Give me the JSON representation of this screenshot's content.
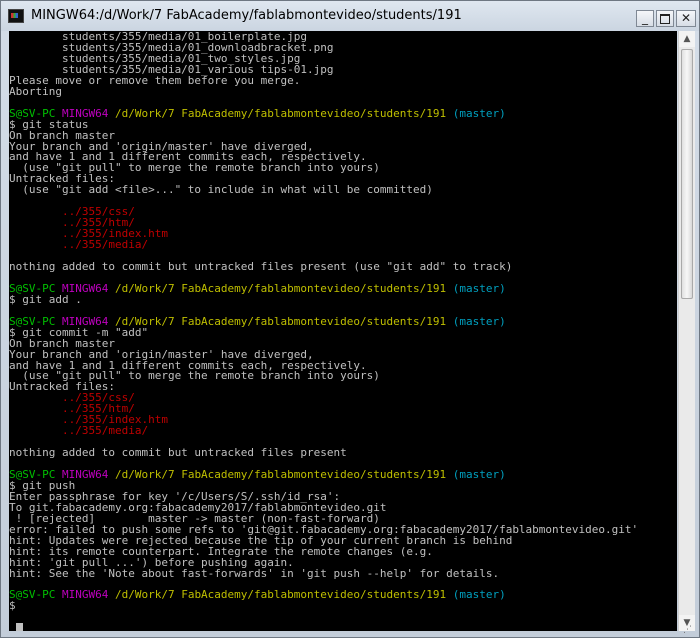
{
  "window": {
    "title": "MINGW64:/d/Work/7 FabAcademy/fablabmontevideo/students/191",
    "minimize": "_",
    "close": "✕"
  },
  "colors": {
    "green": "#00bf00",
    "magenta": "#bf00bf",
    "yellow": "#bfbf00",
    "cyan": "#00a0bf",
    "red": "#bf0000",
    "white": "#c0c0c0"
  },
  "terminal_lines": [
    [
      [
        "white",
        "        students/355/media/01_boilerplate.jpg"
      ]
    ],
    [
      [
        "white",
        "        students/355/media/01_downloadbracket.png"
      ]
    ],
    [
      [
        "white",
        "        students/355/media/01_two_styles.jpg"
      ]
    ],
    [
      [
        "white",
        "        students/355/media/01_various tips-01.jpg"
      ]
    ],
    [
      [
        "white",
        "Please move or remove them before you merge."
      ]
    ],
    [
      [
        "white",
        "Aborting"
      ]
    ],
    [
      [
        "white",
        ""
      ]
    ],
    [
      [
        "green",
        "S@SV-PC "
      ],
      [
        "magenta",
        "MINGW64 "
      ],
      [
        "yellow",
        "/d/Work/7 FabAcademy/fablabmontevideo/students/191"
      ],
      [
        "cyan",
        " (master)"
      ]
    ],
    [
      [
        "white",
        "$ git status"
      ]
    ],
    [
      [
        "white",
        "On branch master"
      ]
    ],
    [
      [
        "white",
        "Your branch and 'origin/master' have diverged,"
      ]
    ],
    [
      [
        "white",
        "and have 1 and 1 different commits each, respectively."
      ]
    ],
    [
      [
        "white",
        "  (use \"git pull\" to merge the remote branch into yours)"
      ]
    ],
    [
      [
        "white",
        "Untracked files:"
      ]
    ],
    [
      [
        "white",
        "  (use \"git add <file>...\" to include in what will be committed)"
      ]
    ],
    [
      [
        "white",
        ""
      ]
    ],
    [
      [
        "white",
        "        "
      ],
      [
        "red",
        "../355/css/"
      ]
    ],
    [
      [
        "white",
        "        "
      ],
      [
        "red",
        "../355/htm/"
      ]
    ],
    [
      [
        "white",
        "        "
      ],
      [
        "red",
        "../355/index.htm"
      ]
    ],
    [
      [
        "white",
        "        "
      ],
      [
        "red",
        "../355/media/"
      ]
    ],
    [
      [
        "white",
        ""
      ]
    ],
    [
      [
        "white",
        "nothing added to commit but untracked files present (use \"git add\" to track)"
      ]
    ],
    [
      [
        "white",
        ""
      ]
    ],
    [
      [
        "green",
        "S@SV-PC "
      ],
      [
        "magenta",
        "MINGW64 "
      ],
      [
        "yellow",
        "/d/Work/7 FabAcademy/fablabmontevideo/students/191"
      ],
      [
        "cyan",
        " (master)"
      ]
    ],
    [
      [
        "white",
        "$ git add ."
      ]
    ],
    [
      [
        "white",
        ""
      ]
    ],
    [
      [
        "green",
        "S@SV-PC "
      ],
      [
        "magenta",
        "MINGW64 "
      ],
      [
        "yellow",
        "/d/Work/7 FabAcademy/fablabmontevideo/students/191"
      ],
      [
        "cyan",
        " (master)"
      ]
    ],
    [
      [
        "white",
        "$ git commit -m \"add\""
      ]
    ],
    [
      [
        "white",
        "On branch master"
      ]
    ],
    [
      [
        "white",
        "Your branch and 'origin/master' have diverged,"
      ]
    ],
    [
      [
        "white",
        "and have 1 and 1 different commits each, respectively."
      ]
    ],
    [
      [
        "white",
        "  (use \"git pull\" to merge the remote branch into yours)"
      ]
    ],
    [
      [
        "white",
        "Untracked files:"
      ]
    ],
    [
      [
        "white",
        "        "
      ],
      [
        "red",
        "../355/css/"
      ]
    ],
    [
      [
        "white",
        "        "
      ],
      [
        "red",
        "../355/htm/"
      ]
    ],
    [
      [
        "white",
        "        "
      ],
      [
        "red",
        "../355/index.htm"
      ]
    ],
    [
      [
        "white",
        "        "
      ],
      [
        "red",
        "../355/media/"
      ]
    ],
    [
      [
        "white",
        ""
      ]
    ],
    [
      [
        "white",
        "nothing added to commit but untracked files present"
      ]
    ],
    [
      [
        "white",
        ""
      ]
    ],
    [
      [
        "green",
        "S@SV-PC "
      ],
      [
        "magenta",
        "MINGW64 "
      ],
      [
        "yellow",
        "/d/Work/7 FabAcademy/fablabmontevideo/students/191"
      ],
      [
        "cyan",
        " (master)"
      ]
    ],
    [
      [
        "white",
        "$ git push"
      ]
    ],
    [
      [
        "white",
        "Enter passphrase for key '/c/Users/S/.ssh/id_rsa':"
      ]
    ],
    [
      [
        "white",
        "To git.fabacademy.org:fabacademy2017/fablabmontevideo.git"
      ]
    ],
    [
      [
        "white",
        " ! [rejected]        master -> master (non-fast-forward)"
      ]
    ],
    [
      [
        "white",
        "error: failed to push some refs to 'git@git.fabacademy.org:fabacademy2017/fablabmontevideo.git'"
      ]
    ],
    [
      [
        "white",
        "hint: Updates were rejected because the tip of your current branch is behind"
      ]
    ],
    [
      [
        "white",
        "hint: its remote counterpart. Integrate the remote changes (e.g."
      ]
    ],
    [
      [
        "white",
        "hint: 'git pull ...') before pushing again."
      ]
    ],
    [
      [
        "white",
        "hint: See the 'Note about fast-forwards' in 'git push --help' for details."
      ]
    ],
    [
      [
        "white",
        ""
      ]
    ],
    [
      [
        "green",
        "S@SV-PC "
      ],
      [
        "magenta",
        "MINGW64 "
      ],
      [
        "yellow",
        "/d/Work/7 FabAcademy/fablabmontevideo/students/191"
      ],
      [
        "cyan",
        " (master)"
      ]
    ],
    [
      [
        "white",
        "$"
      ]
    ]
  ]
}
